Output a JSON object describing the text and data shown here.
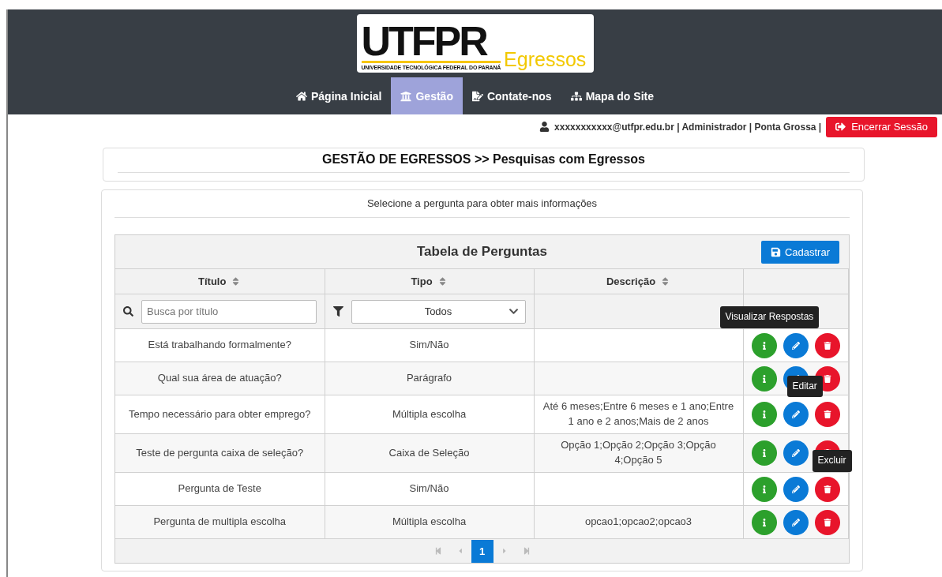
{
  "logo": {
    "mark": "UTFPR",
    "university": "UNIVERSIDADE TECNOLÓGICA FEDERAL DO PARANÁ",
    "subtitle": "Egressos"
  },
  "nav": [
    {
      "kind": "home",
      "label": "Página Inicial",
      "selected": false
    },
    {
      "kind": "bank",
      "label": "Gestão",
      "selected": true
    },
    {
      "kind": "contact",
      "label": "Contate-nos",
      "selected": false
    },
    {
      "kind": "sitemap",
      "label": "Mapa do Site",
      "selected": false
    }
  ],
  "user": {
    "info": "xxxxxxxxxxx@utfpr.edu.br | Administrador | Ponta Grossa |",
    "logout": "Encerrar Sessão"
  },
  "breadcrumb": "GESTÃO DE EGRESSOS >> Pesquisas com Egressos",
  "instruction": "Selecione a pergunta para obter mais informações",
  "table": {
    "title": "Tabela de Perguntas",
    "add_button": "Cadastrar",
    "columns": [
      "Título",
      "Tipo",
      "Descrição"
    ],
    "search_placeholder": "Busca por título",
    "type_filter": "Todos",
    "rows": [
      {
        "title": "Está trabalhando formalmente?",
        "type": "Sim/Não",
        "description": "",
        "info_tooltip": "Visualizar Respostas"
      },
      {
        "title": "Qual sua área de atuação?",
        "type": "Parágrafo",
        "description": ""
      },
      {
        "title": "Tempo necessário para obter emprego?",
        "type": "Múltipla escolha",
        "description": "Até 6 meses;Entre 6 meses e 1 ano;Entre 1 ano e 2 anos;Mais de 2 anos",
        "edit_tooltip": "Editar"
      },
      {
        "title": "Teste de pergunta caixa de seleção?",
        "type": "Caixa de Seleção",
        "description": "Opção 1;Opção 2;Opção 3;Opção 4;Opção 5"
      },
      {
        "title": "Pergunta de Teste",
        "type": "Sim/Não",
        "description": "",
        "delete_tooltip": "Excluir"
      },
      {
        "title": "Pergunta de multipla escolha",
        "type": "Múltipla escolha",
        "description": "opcao1;opcao2;opcao3"
      }
    ],
    "pages": [
      {
        "label": "1",
        "selected": true
      }
    ]
  }
}
